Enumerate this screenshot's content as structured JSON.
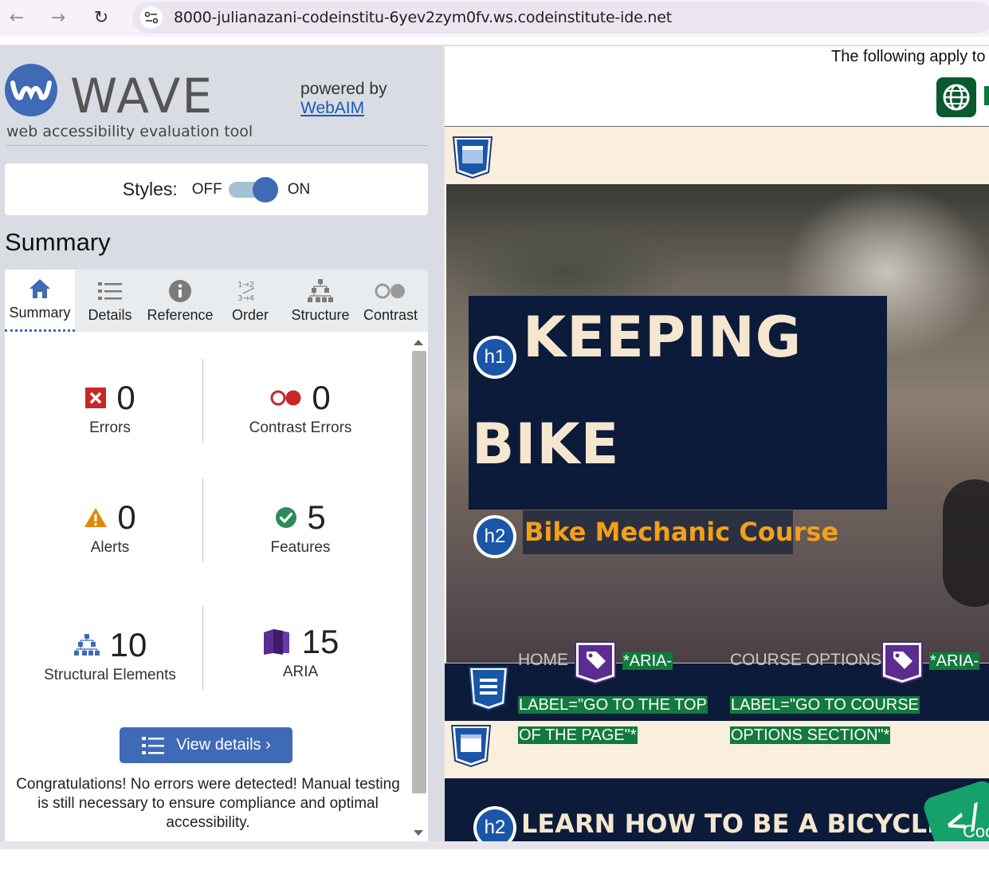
{
  "browser": {
    "back_icon": "arrow-left-icon",
    "forward_icon": "arrow-right-icon",
    "reload_icon": "reload-icon",
    "url": "8000-julianazani-codeinstitu-6yev2zym0fv.ws.codeinstitute-ide.net"
  },
  "wave": {
    "title": "WAVE",
    "subtitle": "web accessibility evaluation tool",
    "powered_by": "powered by",
    "webaim_link": "WebAIM",
    "styles_label": "Styles:",
    "styles_off": "OFF",
    "styles_on": "ON",
    "styles_enabled": true,
    "summary_heading": "Summary",
    "tabs": [
      {
        "label": "Summary",
        "icon": "home-icon",
        "active": true
      },
      {
        "label": "Details",
        "icon": "list-icon",
        "active": false
      },
      {
        "label": "Reference",
        "icon": "info-icon",
        "active": false
      },
      {
        "label": "Order",
        "icon": "order-icon",
        "active": false
      },
      {
        "label": "Structure",
        "icon": "structure-icon",
        "active": false
      },
      {
        "label": "Contrast",
        "icon": "contrast-icon",
        "active": false
      }
    ],
    "stats": {
      "errors": {
        "value": "0",
        "label": "Errors"
      },
      "contrast_errors": {
        "value": "0",
        "label": "Contrast Errors"
      },
      "alerts": {
        "value": "0",
        "label": "Alerts"
      },
      "features": {
        "value": "5",
        "label": "Features"
      },
      "structural": {
        "value": "10",
        "label": "Structural Elements"
      },
      "aria": {
        "value": "15",
        "label": "ARIA"
      }
    },
    "view_details": "View details ›",
    "congrats": "Congratulations! No errors were detected! Manual testing is still necessary to ensure compliance and optimal accessibility."
  },
  "page": {
    "following_text": "The following apply to",
    "h1_line1": "KEEPING",
    "h1_line2": "BIKE",
    "h1_badge": "h1",
    "h2_badge": "h2",
    "h2_text": "Bike Mechanic Course",
    "nav_home": "HOME",
    "nav_course": "COURSE OPTIONS",
    "aria_home_1": "*ARIA-",
    "aria_home_2": "LABEL=\"GO TO THE TOP",
    "aria_home_3": "OF THE PAGE\"*",
    "aria_course_1": "*ARIA-",
    "aria_course_2": "LABEL=\"GO TO COURSE",
    "aria_course_3": "OPTIONS SECTION\"*",
    "h2_bottom": "LEARN HOW TO BE A BICYCLE ME",
    "code_badge": "</",
    "code_sub": "Coo"
  },
  "colors": {
    "wave_blue": "#3f6ab5",
    "navy": "#0c1b3a",
    "cream": "#faefdc",
    "orange": "#f2a01a",
    "aria_green": "#127a3d"
  }
}
